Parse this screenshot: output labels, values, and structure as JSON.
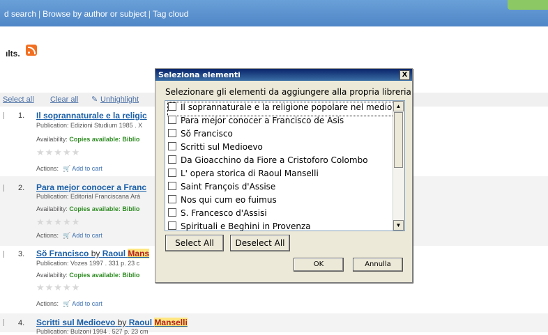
{
  "nav": {
    "links": [
      "d search",
      "Browse by author or subject",
      "Tag cloud"
    ]
  },
  "results_label": "ılts.",
  "toolbar": {
    "select_all": "Select all",
    "clear_all": "Clear all",
    "unhighlight": "Unhighlight"
  },
  "results": [
    {
      "num": "1.",
      "title": "Il soprannaturale e la religic",
      "publication": "Publication: Edizioni Studium 1985 . X",
      "availability_label": "Availability:",
      "availability_value": "Copies available: Biblio",
      "actions_label": "Actions:",
      "add_to_cart": "Add to cart"
    },
    {
      "num": "2.",
      "title": "Para mejor conocer a Franc",
      "publication": "Publication: Editorial Franciscana Ará",
      "availability_label": "Availability:",
      "availability_value": "Copies available: Biblio",
      "actions_label": "Actions:",
      "add_to_cart": "Add to cart"
    },
    {
      "num": "3.",
      "title": "Sŏ Francisco",
      "by": "by",
      "author_first": "Raoul",
      "author_last": "Mans",
      "publication": "Publication: Vozes 1997 . 331 p. 23 c",
      "availability_label": "Availability:",
      "availability_value": "Copies available: Biblio",
      "actions_label": "Actions:",
      "add_to_cart": "Add to cart"
    },
    {
      "num": "4.",
      "title": "Scritti sul Medioevo",
      "by": "by",
      "author_first": "Raoul",
      "author_last": "Manselli",
      "publication": "Publication: Bulzoni 1994 . 527 p. 23 cm"
    }
  ],
  "dialog": {
    "title": "Seleziona elementi",
    "close": "X",
    "prompt": "Selezionare gli elementi da aggiungere alla propria libreria",
    "items": [
      "Il soprannaturale e la religione popolare nel medioevo",
      "Para mejor conocer a Francisco de Asis",
      "Sŏ Francisco",
      "Scritti sul Medioevo",
      "Da Gioacchino da Fiore a Cristoforo Colombo",
      "L' opera storica di Raoul Manselli",
      "Saint François d'Assise",
      "Nos qui cum eo fuimus",
      "S. Francesco d'Assisi",
      "Spirituali e Beghini in Provenza"
    ],
    "select_all": "Select All",
    "deselect_all": "Deselect All",
    "ok": "OK",
    "cancel": "Annulla"
  }
}
